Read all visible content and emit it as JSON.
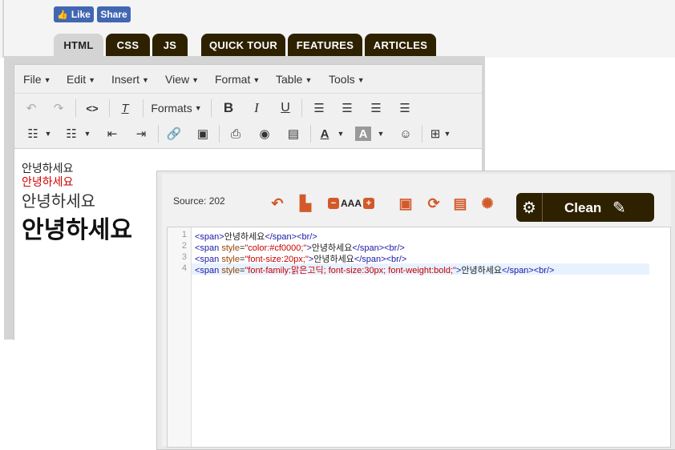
{
  "social": {
    "like": "Like",
    "share": "Share"
  },
  "tabs": [
    "HTML",
    "CSS",
    "JS",
    "QUICK TOUR",
    "FEATURES",
    "ARTICLES"
  ],
  "menu": [
    "File",
    "Edit",
    "Insert",
    "View",
    "Format",
    "Table",
    "Tools"
  ],
  "toolbar": {
    "formats": "Formats"
  },
  "content": {
    "line1": "안녕하세요",
    "line2": "안녕하세요",
    "line3": "안녕하세요",
    "line4": "안녕하세요"
  },
  "source": {
    "label": "Source: 202",
    "clean": "Clean",
    "fontsize_label": "AAA",
    "line_numbers": [
      "1",
      "2",
      "3",
      "4"
    ],
    "lines": [
      [
        "<span>",
        "안녕하세요",
        "</span><br/>"
      ],
      [
        "<span ",
        "style",
        "=",
        "\"color:#cf0000;\"",
        ">",
        "안녕하세요",
        "</span><br/>"
      ],
      [
        "<span ",
        "style",
        "=",
        "\"font-size:20px;\"",
        ">",
        "안녕하세요",
        "</span><br/>"
      ],
      [
        "<span ",
        "style",
        "=",
        "\"font-family:맑은고딕; font-size:30px; font-weight:bold;\"",
        ">",
        "안녕하세요",
        "</span><br/>"
      ]
    ]
  },
  "colors": {
    "tab_dark": "#2e2100",
    "accent": "#d25a2a",
    "facebook": "#4267b2",
    "red_text": "#cf0000"
  }
}
